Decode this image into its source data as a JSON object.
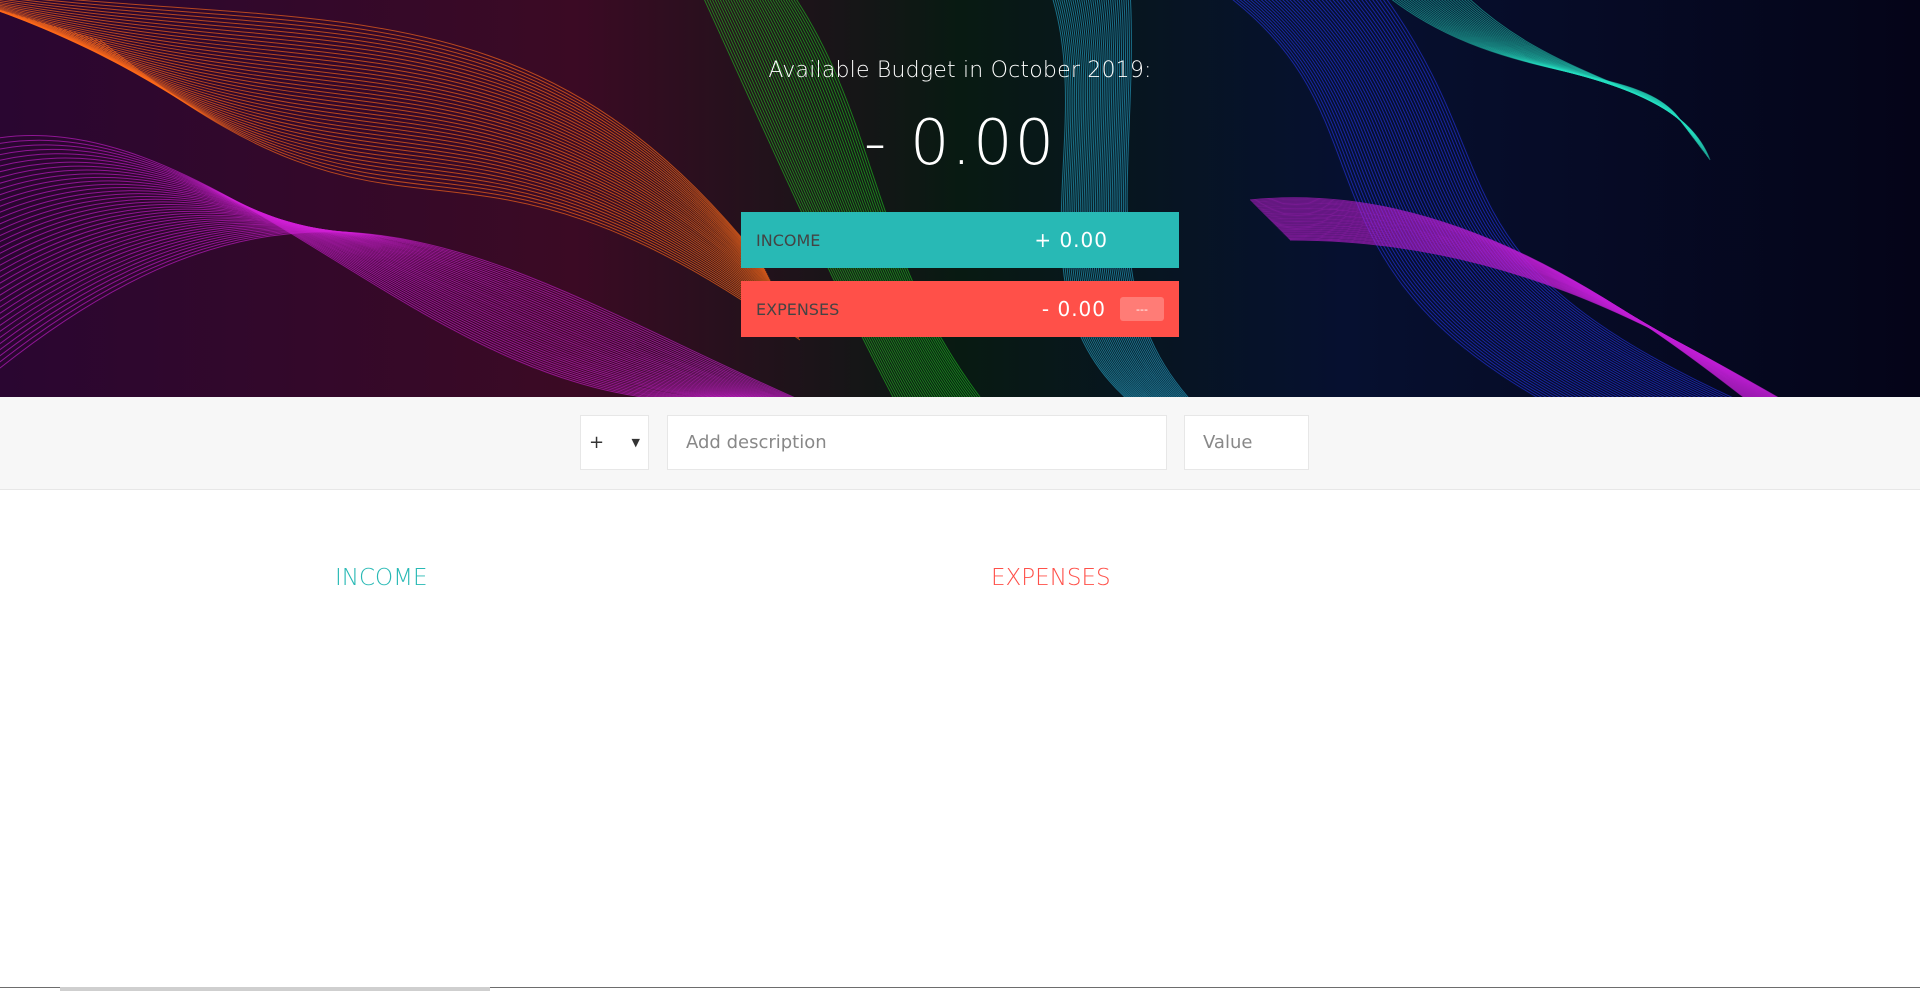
{
  "budget": {
    "title": "Available Budget in October 2019:",
    "value": "- 0.00"
  },
  "summary": {
    "income": {
      "label": "INCOME",
      "value": "+ 0.00"
    },
    "expenses": {
      "label": "EXPENSES",
      "value": "- 0.00",
      "percentage": "---"
    }
  },
  "add": {
    "type_options": [
      "+"
    ],
    "type_selected": "+",
    "description_placeholder": "Add description",
    "description_value": "",
    "value_placeholder": "Value",
    "value_value": ""
  },
  "lists": {
    "income_title": "INCOME",
    "expenses_title": "EXPENSES"
  },
  "colors": {
    "income": "#28b9b5",
    "expenses": "#ff5049",
    "add_bar": "#f7f7f7"
  },
  "icons": {
    "type_dropdown": "chevron-down-icon"
  }
}
